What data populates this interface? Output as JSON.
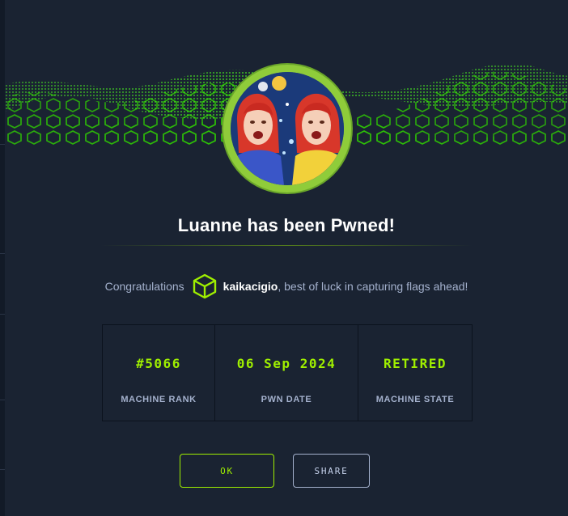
{
  "modal": {
    "title": "Luanne has been Pwned!",
    "congrats_prefix": "Congratulations",
    "username": "kaikacigio",
    "congrats_suffix": ", best of luck in capturing flags ahead!"
  },
  "stats": [
    {
      "value": "#5066",
      "label": "MACHINE RANK"
    },
    {
      "value": "06 Sep 2024",
      "label": "PWN DATE"
    },
    {
      "value": "RETIRED",
      "label": "MACHINE STATE"
    }
  ],
  "buttons": {
    "ok_label": "OK",
    "share_label": "SHARE"
  },
  "colors": {
    "accent": "#9fef00",
    "background": "#1a2332",
    "text_muted": "#a4b1cd",
    "avatar_ring": "#8fcc3a"
  },
  "icons": {
    "user_badge": "hackthebox-cube-icon"
  }
}
